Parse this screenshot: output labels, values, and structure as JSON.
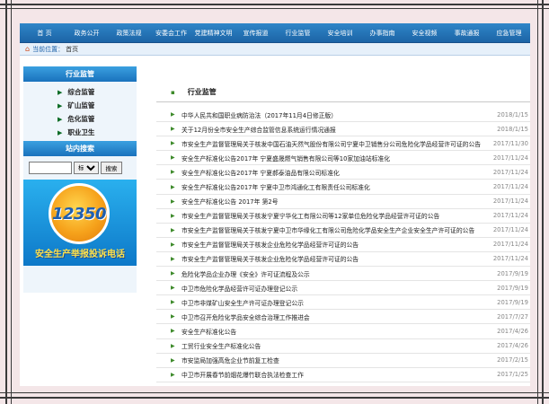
{
  "nav": [
    "首 页",
    "政务公开",
    "政策法规",
    "安委会工作",
    "党建精神文明",
    "宣传报道",
    "行业监管",
    "安全培训",
    "办事指南",
    "安全视频",
    "事故通报",
    "应急管理"
  ],
  "breadcrumb": {
    "label": "当前位置：",
    "path": "首页"
  },
  "sidebar": {
    "industry_title": "行业监管",
    "items": [
      "综合监管",
      "矿山监管",
      "危化监管",
      "职业卫生"
    ],
    "search_title": "站内搜索",
    "search": {
      "select_value": "标题",
      "button_label": "搜索"
    },
    "banner": {
      "number": "12350",
      "caption": "安全生产举报投诉电话"
    }
  },
  "main": {
    "title": "行业监管",
    "news": [
      {
        "title": "中华人民共和国职业病防治法（2017年11月4日修正版）",
        "date": "2018/1/15"
      },
      {
        "title": "关于12月份全市安全生产综合监管信息系统运行情况通报",
        "date": "2018/1/15"
      },
      {
        "title": "市安全生产监督管理局关于核发中国石油天然气股份有限公司宁夏中卫销售分公司危险化学品经营许可证的公告",
        "date": "2017/11/30"
      },
      {
        "title": "安全生产标准化公告2017年 宁夏盛晟燃气销售有限公司等10家加油站标准化",
        "date": "2017/11/24"
      },
      {
        "title": "安全生产标准化公告2017年 宁夏郝泰油品有限公司标准化",
        "date": "2017/11/24"
      },
      {
        "title": "安全生产标准化公告2017年 宁夏中卫市鸿通化工有限责任公司标准化",
        "date": "2017/11/24"
      },
      {
        "title": "安全生产标准化公告 2017年 第2号",
        "date": "2017/11/24"
      },
      {
        "title": "市安全生产监督管理局关于核发宁夏宁华化工有限公司等12家单位危险化学品经营许可证的公告",
        "date": "2017/11/24"
      },
      {
        "title": "市安全生产监督管理局关于核发宁夏中卫市华缘化工有限公司危险化学品安全生产企业安全生产许可证的公告",
        "date": "2017/11/24"
      },
      {
        "title": "市安全生产监督管理局关于核发企业危险化学品经营许可证的公告",
        "date": "2017/11/24"
      },
      {
        "title": "市安全生产监督管理局关于核发企业危险化学品经营许可证的公告",
        "date": "2017/11/24"
      },
      {
        "title": "危险化学品企业办理《安全》许可证流程及公示",
        "date": "2017/9/19"
      },
      {
        "title": "中卫市危险化学品经营许可证办理登记公示",
        "date": "2017/9/19"
      },
      {
        "title": "中卫市非煤矿山安全生产许可证办理登记公示",
        "date": "2017/9/19"
      },
      {
        "title": "中卫市召开危险化学品安全综合治理工作推进会",
        "date": "2017/7/27"
      },
      {
        "title": "安全生产标准化公告",
        "date": "2017/4/26"
      },
      {
        "title": "工贸行业安全生产标准化公告",
        "date": "2017/4/26"
      },
      {
        "title": "市安监局加强高危企业节前复工检查",
        "date": "2017/2/15"
      },
      {
        "title": "中卫市开展春节前烟花爆竹联合执法检查工作",
        "date": "2017/1/25"
      }
    ]
  },
  "colors": {
    "nav": "#1c64a6",
    "accent": "#3d8a2a",
    "frame_bg": "#f4e6e8"
  },
  "icons": {
    "home": "home-icon",
    "bullet": "triangle-bullet-icon"
  }
}
